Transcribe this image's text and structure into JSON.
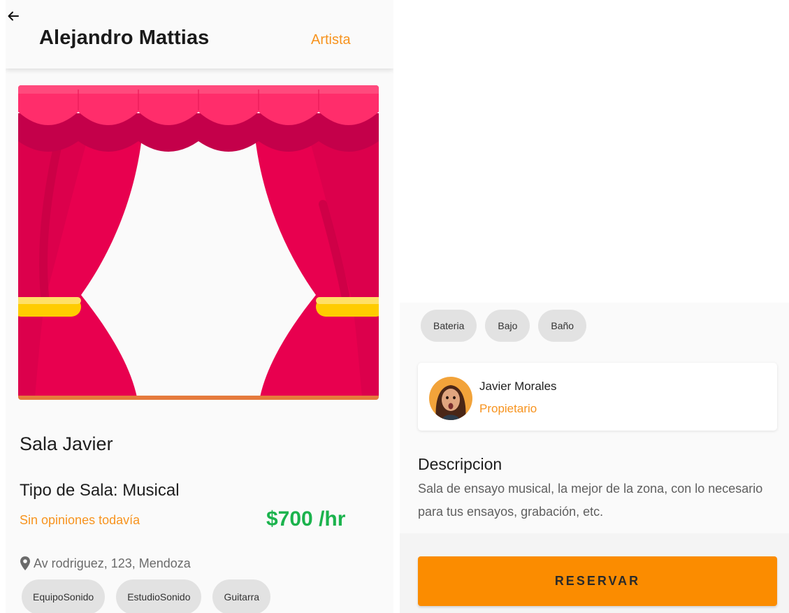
{
  "colors": {
    "accent_orange": "#f7931e",
    "price_green": "#1bb34d",
    "button_orange": "#fb8c00",
    "chip_bg": "#e2e2e2",
    "curtain_pink": "#e8004f"
  },
  "header": {
    "back_icon": "arrow-left-icon",
    "title": "Alejandro Mattias",
    "role_link": "Artista"
  },
  "hero_image": {
    "subject": "theater-curtain-illustration"
  },
  "sala": {
    "name": "Sala Javier",
    "type_label": "Tipo de Sala: Musical",
    "reviews_text": "Sin opiniones todavía",
    "price": "$700 /hr",
    "address_icon": "location-pin-icon",
    "address": "Av rodriguez, 123, Mendoza"
  },
  "features_left": [
    {
      "label": "EquipoSonido"
    },
    {
      "label": "EstudioSonido"
    },
    {
      "label": "Guitarra"
    }
  ],
  "features_right": [
    {
      "label": "Bateria"
    },
    {
      "label": "Bajo"
    },
    {
      "label": "Baño"
    }
  ],
  "owner": {
    "name": "Javier Morales",
    "role": "Propietario"
  },
  "description": {
    "title": "Descripcion",
    "text": "Sala de ensayo musical, la mejor de la zona, con lo necesario para tus ensayos, grabación, etc."
  },
  "actions": {
    "reserve_label": "RESERVAR"
  }
}
